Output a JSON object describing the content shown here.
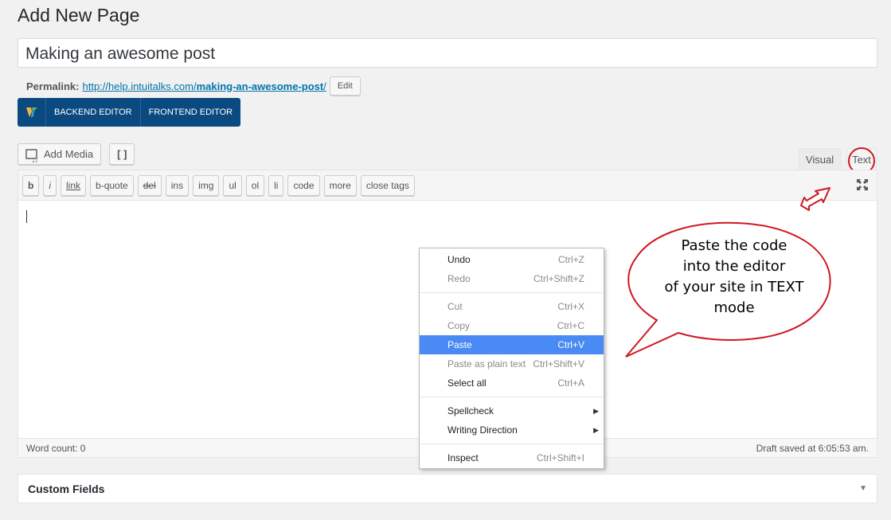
{
  "page": {
    "title": "Add New Page"
  },
  "post": {
    "title": "Making an awesome post"
  },
  "permalink": {
    "label": "Permalink:",
    "base": "http://help.intuitalks.com/",
    "slug": "making-an-awesome-post",
    "trail": "/",
    "edit_label": "Edit"
  },
  "composer": {
    "backend_label": "BACKEND EDITOR",
    "frontend_label": "FRONTEND EDITOR"
  },
  "media": {
    "add_media_label": "Add Media",
    "shortcode_label": "[ ]"
  },
  "tabs": {
    "visual": "Visual",
    "text": "Text"
  },
  "quicktags": [
    "b",
    "i",
    "link",
    "b-quote",
    "del",
    "ins",
    "img",
    "ul",
    "ol",
    "li",
    "code",
    "more",
    "close tags"
  ],
  "status": {
    "word_count": "Word count: 0",
    "draft_saved": "Draft saved at 6:05:53 am."
  },
  "custom_fields": {
    "title": "Custom Fields"
  },
  "context_menu": {
    "undo": {
      "label": "Undo",
      "shortcut": "Ctrl+Z"
    },
    "redo": {
      "label": "Redo",
      "shortcut": "Ctrl+Shift+Z"
    },
    "cut": {
      "label": "Cut",
      "shortcut": "Ctrl+X"
    },
    "copy": {
      "label": "Copy",
      "shortcut": "Ctrl+C"
    },
    "paste": {
      "label": "Paste",
      "shortcut": "Ctrl+V"
    },
    "paste_plain": {
      "label": "Paste as plain text",
      "shortcut": "Ctrl+Shift+V"
    },
    "select_all": {
      "label": "Select all",
      "shortcut": "Ctrl+A"
    },
    "spellcheck": {
      "label": "Spellcheck"
    },
    "writing_direction": {
      "label": "Writing Direction"
    },
    "inspect": {
      "label": "Inspect",
      "shortcut": "Ctrl+Shift+I"
    }
  },
  "callout": {
    "line1": "Paste the code",
    "line2": "into the editor",
    "line3": "of your site in TEXT",
    "line4": "mode"
  },
  "colors": {
    "accent_blue": "#0b4a80",
    "link": "#0073aa",
    "highlight": "#4a8af4",
    "annotation_red": "#d0181e"
  }
}
